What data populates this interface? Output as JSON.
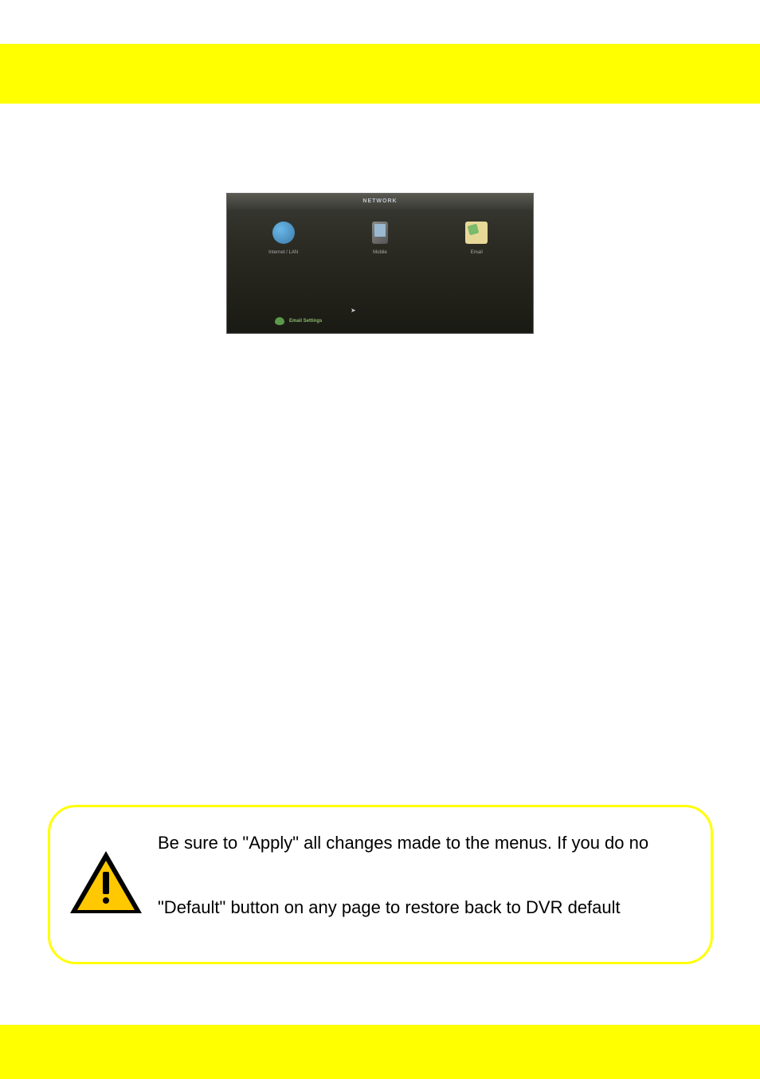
{
  "screenshot": {
    "header": "NETWORK",
    "items": [
      {
        "icon": "globe",
        "label": "Internet / LAN"
      },
      {
        "icon": "mobile",
        "label": "Mobile"
      },
      {
        "icon": "email",
        "label": "Email"
      }
    ],
    "footer_label": "Email Settings"
  },
  "callout": {
    "line1": "Be sure to \"Apply\" all changes made to the menus. If you do no",
    "line2": "\"Default\" button on any page to restore back to DVR default"
  }
}
